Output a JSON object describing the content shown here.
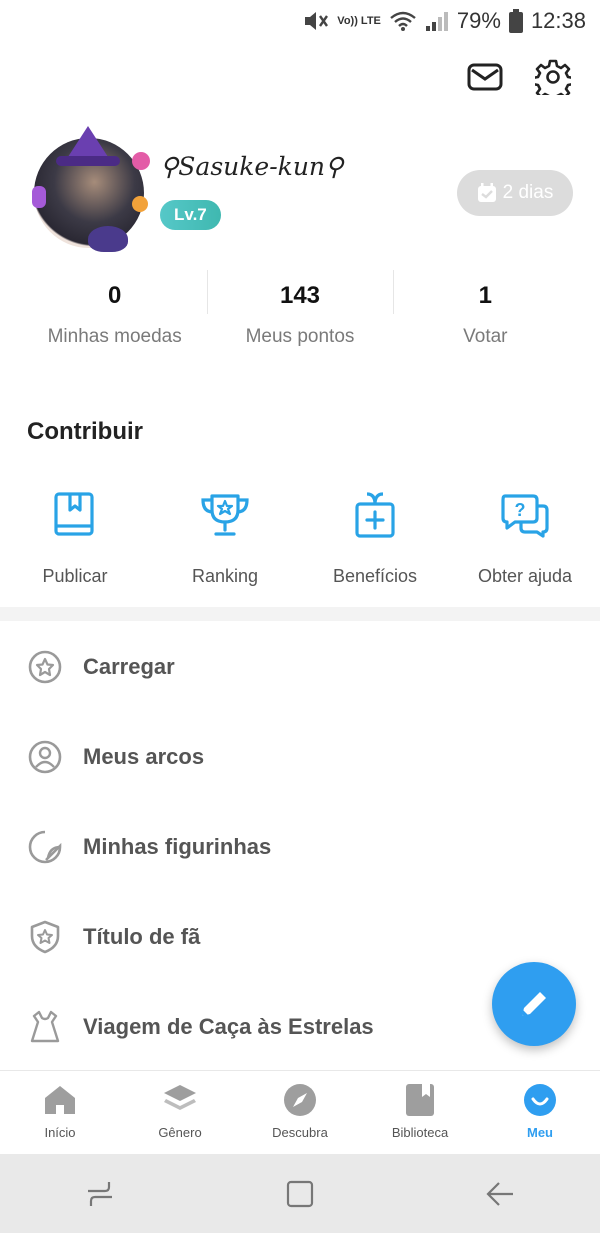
{
  "status_bar": {
    "battery": "79%",
    "time": "12:38",
    "network": "Vo)) LTE"
  },
  "profile": {
    "username": "⚲Sasuke-kun⚲",
    "level": "Lv.7",
    "checkin_label": "2 dias"
  },
  "stats": [
    {
      "value": "0",
      "label": "Minhas moedas"
    },
    {
      "value": "143",
      "label": "Meus pontos"
    },
    {
      "value": "1",
      "label": "Votar"
    }
  ],
  "contribute": {
    "title": "Contribuir",
    "items": [
      {
        "label": "Publicar",
        "icon": "book-icon"
      },
      {
        "label": "Ranking",
        "icon": "trophy-icon"
      },
      {
        "label": "Benefícios",
        "icon": "gift-icon"
      },
      {
        "label": "Obter ajuda",
        "icon": "help-chat-icon"
      }
    ]
  },
  "menu": [
    {
      "label": "Carregar",
      "icon": "star-circle-icon"
    },
    {
      "label": "Meus arcos",
      "icon": "user-circle-icon"
    },
    {
      "label": "Minhas figurinhas",
      "icon": "sticker-icon"
    },
    {
      "label": "Título de fã",
      "icon": "shield-star-icon"
    },
    {
      "label": "Viagem de Caça às Estrelas",
      "icon": "dress-icon"
    }
  ],
  "bottom_nav": [
    {
      "label": "Início",
      "icon": "home-icon"
    },
    {
      "label": "Gênero",
      "icon": "layers-icon"
    },
    {
      "label": "Descubra",
      "icon": "compass-icon"
    },
    {
      "label": "Biblioteca",
      "icon": "bookmark-book-icon"
    },
    {
      "label": "Meu",
      "icon": "smile-icon",
      "active": true
    }
  ],
  "colors": {
    "accent": "#2f9ef0",
    "level_badge": "#3fb8b0",
    "icon_blue": "#29a3e6",
    "menu_icon_gray": "#9a9a9a"
  }
}
